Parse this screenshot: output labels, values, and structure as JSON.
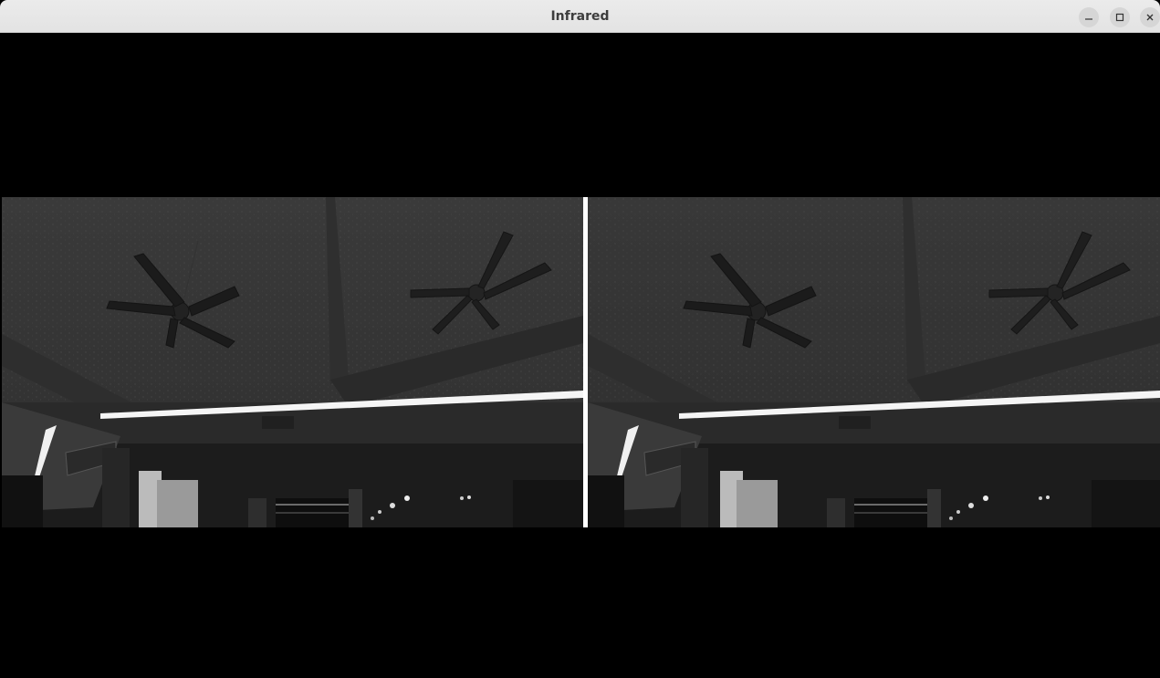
{
  "window": {
    "title": "Infrared",
    "controls": {
      "minimize": "minimize-icon",
      "maximize": "maximize-icon",
      "close": "close-icon"
    }
  },
  "stream": {
    "frames": [
      {
        "name": "left-infrared-frame"
      },
      {
        "name": "right-infrared-frame"
      }
    ],
    "colors": {
      "background": "#000000",
      "separator": "#ffffff"
    }
  }
}
